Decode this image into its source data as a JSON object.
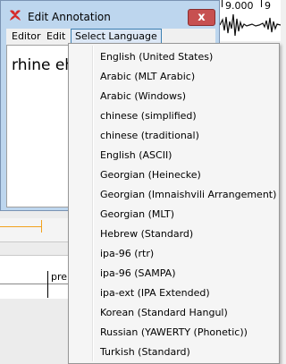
{
  "background": {
    "ruler_label_1": "9.000",
    "ruler_label_2": "9",
    "track_label": "pre"
  },
  "window": {
    "title": "Edit Annotation",
    "close_glyph": "x",
    "menu": {
      "editor": "Editor",
      "edit": "Edit",
      "select_language": "Select Language"
    },
    "content_text": "rhine eh"
  },
  "dropdown": {
    "items": [
      "English (United States)",
      "Arabic (MLT Arabic)",
      "Arabic (Windows)",
      "chinese (simplified)",
      "chinese (traditional)",
      "English (ASCII)",
      "Georgian (Heinecke)",
      "Georgian (Imnaishvili Arrangement)",
      "Georgian (MLT)",
      "Hebrew (Standard)",
      "ipa-96 (rtr)",
      "ipa-96 (SAMPA)",
      "ipa-ext (IPA Extended)",
      "Korean (Standard Hangul)",
      "Russian (YAWERTY (Phonetic))",
      "Turkish (Standard)"
    ]
  },
  "colors": {
    "title_bar": "#bdd6ee",
    "close_button": "#c75050",
    "menu_highlight": "#dde8f6",
    "accent_orange": "#f2a21d"
  }
}
